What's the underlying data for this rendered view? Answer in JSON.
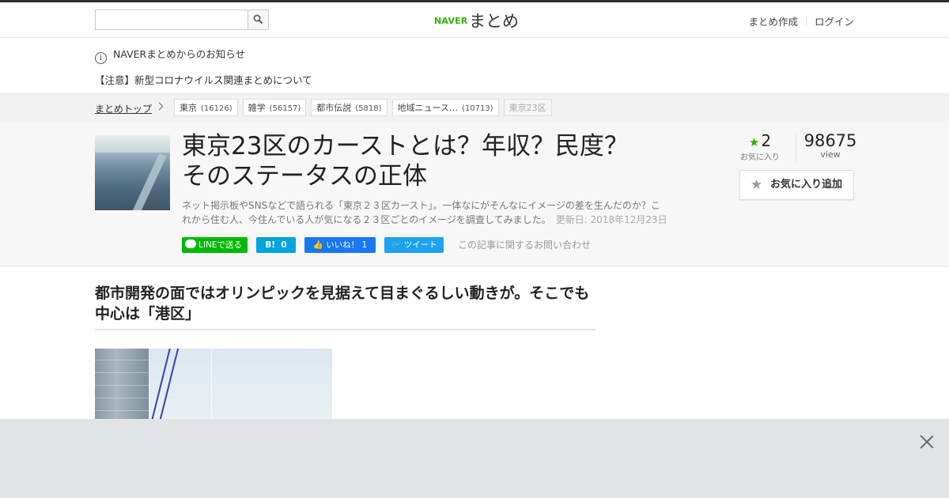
{
  "header": {
    "search_placeholder": "",
    "logo_brand": "NAVER",
    "logo_service": "まとめ",
    "create_link": "まとめ作成",
    "login_link": "ログイン"
  },
  "notice": {
    "title": "NAVERまとめからのお知らせ",
    "item": "【注意】新型コロナウイルス関連まとめについて"
  },
  "breadcrumb": {
    "top": "まとめトップ",
    "tags": [
      {
        "label": "東京",
        "count": "(16126)"
      },
      {
        "label": "雑学",
        "count": "(56157)"
      },
      {
        "label": "都市伝説",
        "count": "(5818)"
      },
      {
        "label": "地域ニュース…",
        "count": "(10713)"
      }
    ],
    "current": "東京23区"
  },
  "article": {
    "title_line1": "東京23区のカーストとは？年収？民度？",
    "title_line2": "そのステータスの正体",
    "description": "ネット掲示板やSNSなどで語られる「東京２３区カースト」。一体なにがそんなにイメージの差を生んだのか？これから住む人、今住んでいる人が気になる２３区ごとのイメージを調査してみました。",
    "updated": "更新日: 2018年12月23日",
    "favorites_count": "2",
    "favorites_label": "お気に入り",
    "views_count": "98675",
    "views_label": "view",
    "add_favorite": "お気に入り追加"
  },
  "share": {
    "line": "LINEで送る",
    "hatena_icon": "B!",
    "hatena_count": "0",
    "facebook": "いいね！",
    "facebook_count": "1",
    "twitter": "ツイート",
    "inquiry": "この記事に関するお問い合わせ"
  },
  "section": {
    "heading": "都市開発の面ではオリンピックを見据えて目まぐるしい動きが。そこでも中心は「港区」"
  },
  "colors": {
    "brand_green": "#2db400",
    "line_green": "#00b900",
    "hatena_blue": "#00a4de",
    "facebook_blue": "#1877f2",
    "twitter_blue": "#1da1f2"
  }
}
